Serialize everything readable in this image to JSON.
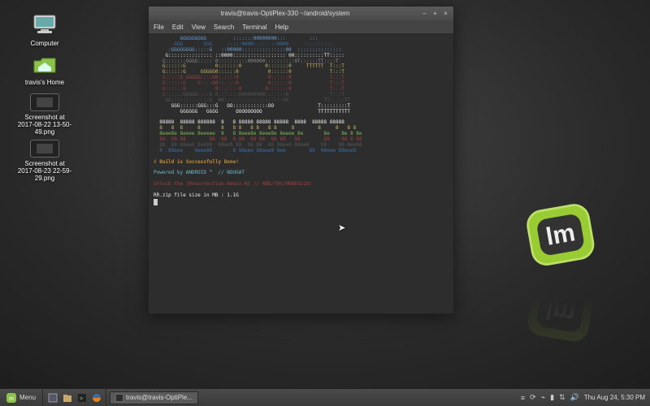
{
  "desktop_icons": {
    "computer": {
      "label": "Computer"
    },
    "home": {
      "label": "travis's Home"
    },
    "shot1": {
      "label": "Screenshot at 2017-08-22 13-50-49.png"
    },
    "shot2": {
      "label": "Screenshot at 2017-08-23 22-59-29.png"
    }
  },
  "window": {
    "title": "travis@travis-OptiPlex-330 ~/android/system",
    "menu": {
      "file": "File",
      "edit": "Edit",
      "view": "View",
      "search": "Search",
      "terminal": "Terminal",
      "help": "Help"
    },
    "controls": {
      "min": "–",
      "max": "+",
      "close": "×"
    }
  },
  "term": {
    "ascii_goo_1": "         GGGGGGGGG         :::::::00000000:::        :::           ",
    "ascii_goo_2": "       GGG       GGG     :::::0000::::::::0000     ::::::::::       ",
    "ascii_goo_3": "     :GGGGGGGG:::::G   ::00000:::::::::::::::00  :::::::::::::::    ",
    "ascii_goo_4": "    G::::::::::::::: ::0000:::::::::::::::::: 00::::::::::TT:::::   ",
    "ascii_goo_5": "   G:::::::GGGG::::: 0::::::::::000000::::::::::0T::::::TT::::T     ",
    "ascii_goo_6": "   G::::::G          0:::::::0        0:::::::0     TTTTTT  T:::T   ",
    "ascii_goo_7": "   G::::::G     GGGGG0::::::0          0::::::0             T:::T   ",
    "ascii_goo_8": "   G:::::G GGGGG::::G0::::::0          0::::::0             T:::T   ",
    "ascii_goo_9": "   G::::::G    G::::G0::::::0          0::::::0             T:::T   ",
    "ascii_goo_10": "   G::::::G          0:::::::0        0:::::::0             T:::T   ",
    "ascii_goo_11": "   G::::::GGGGG::::G 0:::::::000000000:::::::0              T:::T   ",
    "ascii_goo_12": "    GG:::::::::::::G  00::::::::::::::::::::00            TT:::::TT ",
    "ascii_goo_13": "      GGG::::::GGG:::G   OO::::::::::::OO               T:::::::::T ",
    "ascii_goo_14": "         GGGGGG   GGGG      OOOOOOOOO                   TTTTTTTTTTT ",
    "band_1": "  88888  88888 888888  8   8 88888 88888 88888  8888  88888 88888   ",
    "band_2": "  8   8  8     8       8   8 8   8 8   8 8     8        8     8   8 8",
    "band_3": "  8eee8e 8eeee 8eeeee  8   8 8eee8e 8eee8e 8eeee 8e       8e    8e 8 8e",
    "band_4": "  88  88 88        88  88  8 88  88 88  88 88   88        88    88 8 88",
    "band_5": "  88  88 88ee8 8ee88  88ee8 88  88 88  88 88ee8 88ee8    88    88 8ee88",
    "band_6": "  8  88eee    8eee88       8 88eee 88eee8 8ee        88  88eee 88eee8",
    "line_success": "√ Build is Successfully Done!",
    "line_powered": "Powered by ANDROID ™  // NOUGAT",
    "line_unlock": "Unlock the [Resurrection-Remix-N] // AND/THX/HNBE8218/",
    "line_size": "RR.zip file size in MB : 1.1G",
    "prompt": ""
  },
  "taskbar": {
    "menu_label": "Menu",
    "task_label": "travis@travis-OptiPle...",
    "clock": "Thu Aug 24,  5:30 PM"
  },
  "icons": {
    "computer": "computer-icon",
    "home": "home-folder-icon",
    "desktop": "show-desktop-icon",
    "files": "files-icon",
    "terminal": "terminal-icon",
    "firefox": "firefox-icon",
    "wifi": "wifi-icon",
    "battery": "battery-icon",
    "volume": "volume-icon",
    "dash": "dash-icon"
  }
}
